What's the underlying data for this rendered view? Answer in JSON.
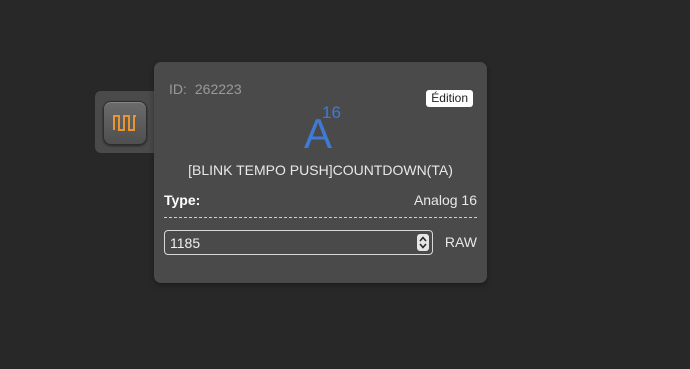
{
  "side_icon": {
    "name": "square-wave-icon",
    "color": "#e8952f"
  },
  "card": {
    "id_label": "ID:",
    "id_value": "262223",
    "edition_badge": "Édition",
    "type_letter": "A",
    "type_superscript": "16",
    "variable_name": "[BLINK TEMPO PUSH]COUNTDOWN(TA)",
    "type_label": "Type:",
    "type_value": "Analog 16",
    "value_input": "1185",
    "unit_label": "RAW",
    "accent_color": "#3f7bd6"
  }
}
